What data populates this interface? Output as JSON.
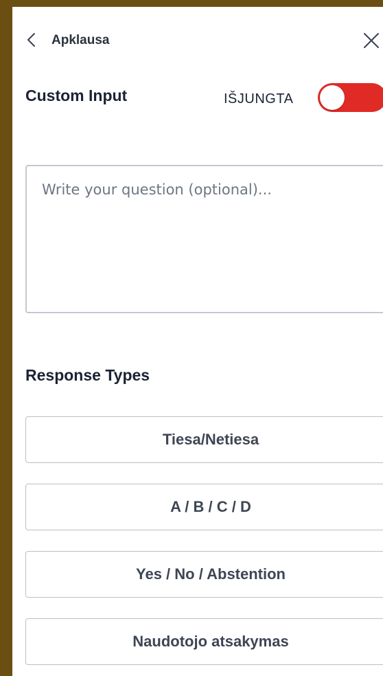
{
  "header": {
    "title": "Apklausa",
    "back_icon": "chevron-left-icon",
    "close_icon": "close-icon"
  },
  "custom_input": {
    "label": "Custom Input",
    "toggle_state_label": "IŠJUNGTA",
    "toggle_on": false,
    "toggle_color": "#e02a26"
  },
  "question": {
    "value": "",
    "placeholder": "Write your question (optional)..."
  },
  "response_types": {
    "heading": "Response Types",
    "options": [
      {
        "label": "Tiesa/Netiesa"
      },
      {
        "label": "A / B / C / D"
      },
      {
        "label": "Yes / No / Abstention"
      },
      {
        "label": "Naudotojo atsakymas"
      }
    ]
  },
  "colors": {
    "frame": "#6b4f12",
    "text_dark": "#1b2333",
    "border": "#b9c0c9"
  }
}
